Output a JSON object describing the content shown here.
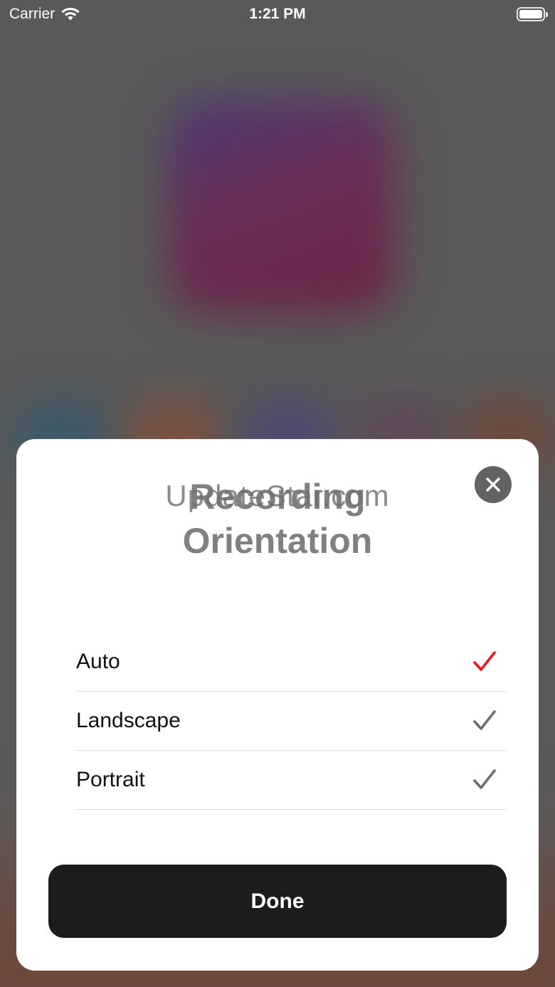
{
  "status_bar": {
    "carrier": "Carrier",
    "time": "1:21 PM",
    "battery_level": 1.0,
    "wifi_icon": "wifi-icon",
    "battery_icon": "battery-icon"
  },
  "sheet": {
    "title": "Recording Orientation",
    "watermark": "UpdateStar.com",
    "close_icon": "close-icon",
    "options": [
      {
        "label": "Auto",
        "selected": true
      },
      {
        "label": "Landscape",
        "selected": false
      },
      {
        "label": "Portrait",
        "selected": false
      }
    ],
    "done_label": "Done"
  },
  "colors": {
    "selected_check": "#f2141e",
    "unselected_check": "#6e6e6e",
    "done_button": "#1c1c1c",
    "close_button": "#636366",
    "title_text": "#808080"
  }
}
